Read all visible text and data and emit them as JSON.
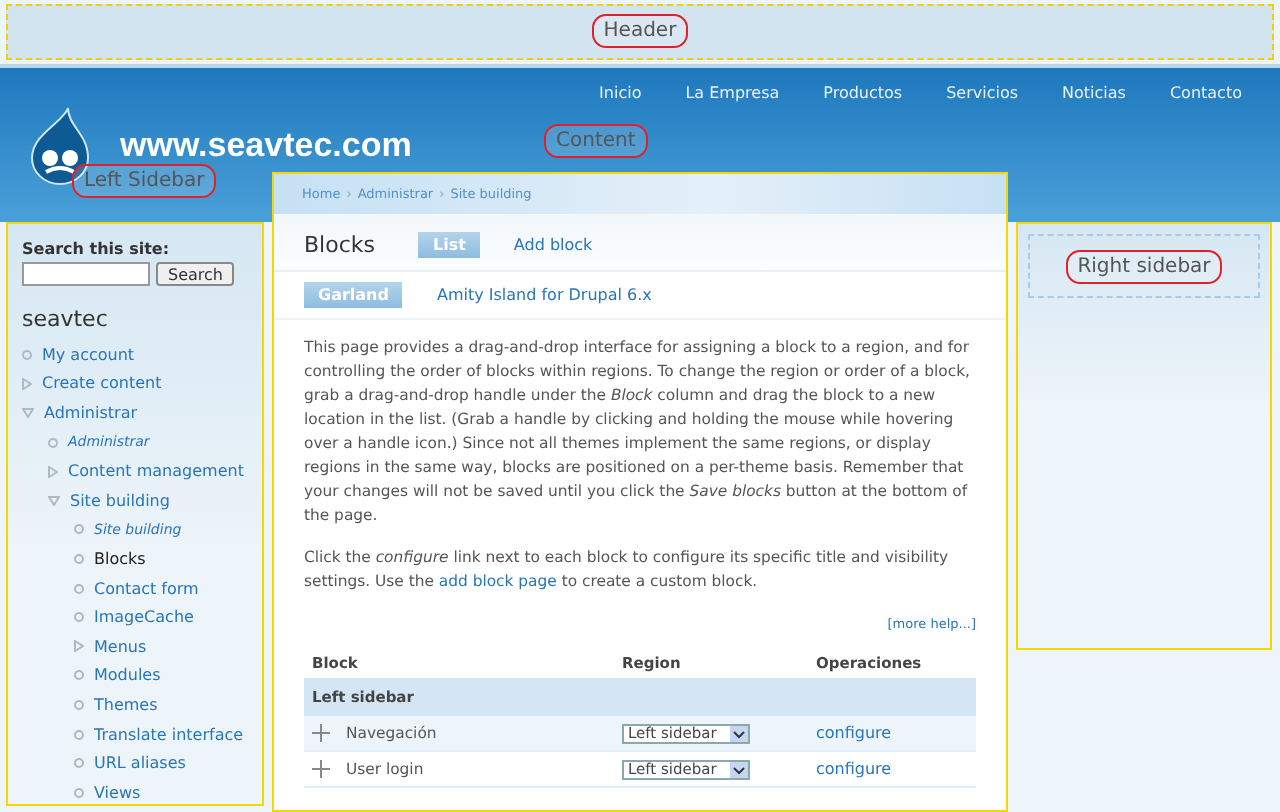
{
  "annotations": {
    "header": "Header",
    "content": "Content",
    "left_sidebar": "Left Sidebar",
    "right_sidebar": "Right sidebar"
  },
  "nav": [
    "Inicio",
    "La Empresa",
    "Productos",
    "Servicios",
    "Noticias",
    "Contacto"
  ],
  "site_name": "www.seavtec.com",
  "search": {
    "label": "Search this site:",
    "button": "Search"
  },
  "menu": {
    "title": "seavtec",
    "items": [
      {
        "label": "My account",
        "kind": "leaf",
        "selected": false
      },
      {
        "label": "Create content",
        "kind": "collapsed",
        "selected": false
      },
      {
        "label": "Administrar",
        "kind": "expanded",
        "selected": false,
        "children": [
          {
            "label": "Administrar",
            "kind": "overview",
            "selected": false
          },
          {
            "label": "Content management",
            "kind": "collapsed",
            "selected": false
          },
          {
            "label": "Site building",
            "kind": "expanded",
            "selected": false,
            "children": [
              {
                "label": "Site building",
                "kind": "overview",
                "selected": false
              },
              {
                "label": "Blocks",
                "kind": "leaf",
                "selected": true
              },
              {
                "label": "Contact form",
                "kind": "leaf",
                "selected": false
              },
              {
                "label": "ImageCache",
                "kind": "leaf",
                "selected": false
              },
              {
                "label": "Menus",
                "kind": "collapsed",
                "selected": false
              },
              {
                "label": "Modules",
                "kind": "leaf",
                "selected": false
              },
              {
                "label": "Themes",
                "kind": "leaf",
                "selected": false
              },
              {
                "label": "Translate interface",
                "kind": "leaf",
                "selected": false
              },
              {
                "label": "URL aliases",
                "kind": "leaf",
                "selected": false
              },
              {
                "label": "Views",
                "kind": "leaf",
                "selected": false
              }
            ]
          }
        ]
      }
    ]
  },
  "breadcrumb": [
    "Home",
    "Administrar",
    "Site building"
  ],
  "breadcrumb_separator": "›",
  "title": "Blocks",
  "tabs": [
    {
      "label": "List",
      "selected": true
    },
    {
      "label": "Add block",
      "selected": false
    }
  ],
  "subtabs": [
    {
      "label": "Garland",
      "selected": true
    },
    {
      "label": "Amity Island for Drupal 6.x",
      "selected": false
    }
  ],
  "intro": "This page provides a drag-and-drop interface for assigning a block to a region, and for controlling the order of blocks within regions. To change the region or order of a block, grab a drag-and-drop handle under the *Block* column and drag the block to a new location in the list. (Grab a handle by clicking and holding the mouse while hovering over a handle icon.) Since not all themes implement the same regions, or display regions in the same way, blocks are positioned on a per-theme basis. Remember that your changes will not be saved until you click the *Save blocks* button at the bottom of the page.",
  "help": {
    "before": "Click the *configure* link next to each block to configure its specific title and visibility settings. Use the ",
    "link": "add block page",
    "after": " to create a custom block."
  },
  "more_help": "[more help...]",
  "table": {
    "columns": [
      "Block",
      "Region",
      "Operaciones"
    ],
    "region": "Left sidebar",
    "rows": [
      {
        "block": "Navegación",
        "region": "Left sidebar",
        "operation": "configure"
      },
      {
        "block": "User login",
        "region": "Left sidebar",
        "operation": "configure"
      }
    ]
  }
}
